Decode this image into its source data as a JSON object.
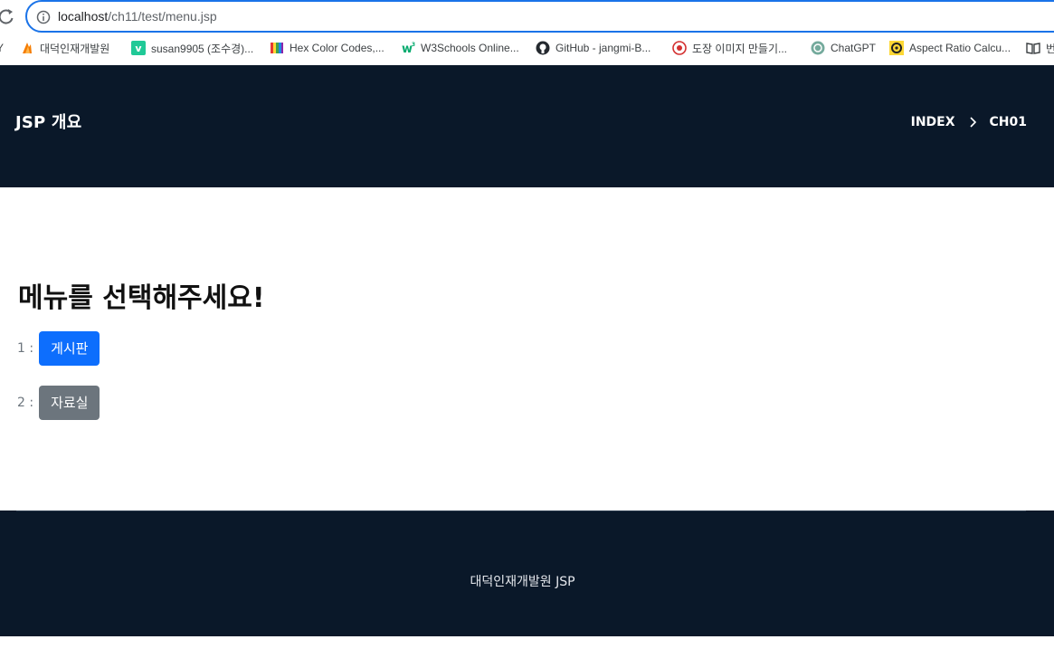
{
  "browser": {
    "url_host": "localhost",
    "url_path": "/ch11/test/menu.jsp",
    "bookmarks": [
      {
        "icon": "fire-icon",
        "label": "대덕인재개발원"
      },
      {
        "icon": "vimeo-icon",
        "label": "susan9905 (조수경)..."
      },
      {
        "icon": "color-book-icon",
        "label": "Hex Color Codes,..."
      },
      {
        "icon": "w3schools-icon",
        "label": "W3Schools Online..."
      },
      {
        "icon": "github-icon",
        "label": "GitHub - jangmi-B..."
      },
      {
        "icon": "seal-icon",
        "label": "도장 이미지 만들기..."
      },
      {
        "icon": "chatgpt-icon",
        "label": "ChatGPT"
      },
      {
        "icon": "aspect-ratio-icon",
        "label": "Aspect Ratio Calcu..."
      },
      {
        "icon": "book-icon",
        "label": "번"
      }
    ]
  },
  "header": {
    "title": "JSP 개요",
    "breadcrumb": [
      "INDEX",
      "CH01"
    ]
  },
  "main": {
    "title": "메뉴를 선택해주세요!",
    "menu": [
      {
        "num": "1 :",
        "label": "게시판",
        "style": "primary"
      },
      {
        "num": "2 :",
        "label": "자료실",
        "style": "secondary"
      }
    ]
  },
  "footer": {
    "text": "대덕인재개발원 JSP"
  },
  "colors": {
    "header_bg": "#0a1829",
    "primary": "#0d6efd",
    "secondary": "#6c757d",
    "url_focus": "#1a73e8"
  }
}
